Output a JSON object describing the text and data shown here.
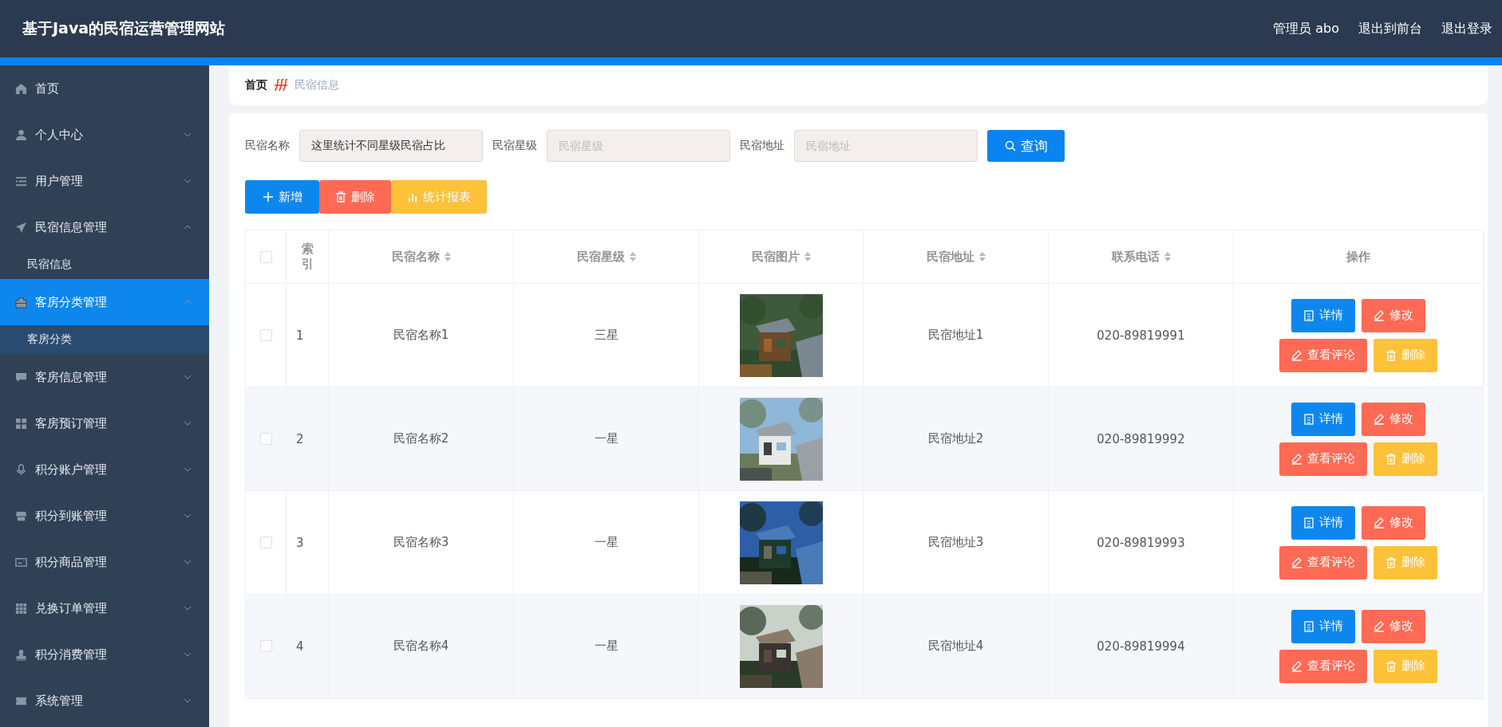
{
  "header": {
    "title": "基于Java的民宿运营管理网站",
    "links": [
      "管理员 abo",
      "退出到前台",
      "退出登录"
    ]
  },
  "sidebar": {
    "items": [
      {
        "label": "首页",
        "expandable": false,
        "selected": false
      },
      {
        "label": "个人中心",
        "expandable": true,
        "expanded": false,
        "selected": false
      },
      {
        "label": "用户管理",
        "expandable": true,
        "expanded": false,
        "selected": false
      },
      {
        "label": "民宿信息管理",
        "expandable": true,
        "expanded": true,
        "selected": false,
        "children": [
          {
            "label": "民宿信息",
            "hovered": false
          }
        ]
      },
      {
        "label": "客房分类管理",
        "expandable": true,
        "expanded": true,
        "selected": true,
        "children": [
          {
            "label": "客房分类",
            "hovered": true
          }
        ]
      },
      {
        "label": "客房信息管理",
        "expandable": true,
        "expanded": false,
        "selected": false
      },
      {
        "label": "客房预订管理",
        "expandable": true,
        "expanded": false,
        "selected": false
      },
      {
        "label": "积分账户管理",
        "expandable": true,
        "expanded": false,
        "selected": false
      },
      {
        "label": "积分到账管理",
        "expandable": true,
        "expanded": false,
        "selected": false
      },
      {
        "label": "积分商品管理",
        "expandable": true,
        "expanded": false,
        "selected": false
      },
      {
        "label": "兑换订单管理",
        "expandable": true,
        "expanded": false,
        "selected": false
      },
      {
        "label": "积分消费管理",
        "expandable": true,
        "expanded": false,
        "selected": false
      },
      {
        "label": "系统管理",
        "expandable": true,
        "expanded": false,
        "selected": false
      }
    ]
  },
  "breadcrumb": [
    "首页",
    "民宿信息"
  ],
  "filters": [
    {
      "label": "民宿名称",
      "value": "这里统计不同星级民宿占比"
    },
    {
      "label": "民宿星级",
      "placeholder": "民宿星级"
    },
    {
      "label": "民宿地址",
      "placeholder": "民宿地址"
    }
  ],
  "search_button": "查询",
  "toolbar": [
    {
      "label": "新增",
      "kind": "add"
    },
    {
      "label": "删除",
      "kind": "delete"
    },
    {
      "label": "统计报表",
      "kind": "report"
    }
  ],
  "table": {
    "all_checked": false,
    "columns": [
      {
        "label": "索引",
        "sortable": false
      },
      {
        "label": "民宿名称",
        "sortable": true
      },
      {
        "label": "民宿星级",
        "sortable": true
      },
      {
        "label": "民宿图片",
        "sortable": true
      },
      {
        "label": "民宿地址",
        "sortable": true
      },
      {
        "label": "联系电话",
        "sortable": true
      },
      {
        "label": "操作",
        "sortable": false
      }
    ],
    "rows": [
      {
        "checked": false,
        "index": "1",
        "name": "民宿名称1",
        "stars": "三星",
        "address": "民宿地址1",
        "phone": "020-89819991",
        "actions": [
          {
            "label": "详情",
            "kind": "detail"
          },
          {
            "label": "修改",
            "kind": "edit"
          },
          {
            "label": "查看评论",
            "kind": "review"
          },
          {
            "label": "删除",
            "kind": "delete"
          }
        ]
      },
      {
        "checked": false,
        "index": "2",
        "name": "民宿名称2",
        "stars": "一星",
        "address": "民宿地址2",
        "phone": "020-89819992",
        "actions": [
          {
            "label": "详情",
            "kind": "detail"
          },
          {
            "label": "修改",
            "kind": "edit"
          },
          {
            "label": "查看评论",
            "kind": "review"
          },
          {
            "label": "删除",
            "kind": "delete"
          }
        ]
      },
      {
        "checked": false,
        "index": "3",
        "name": "民宿名称3",
        "stars": "一星",
        "address": "民宿地址3",
        "phone": "020-89819993",
        "actions": [
          {
            "label": "详情",
            "kind": "detail"
          },
          {
            "label": "修改",
            "kind": "edit"
          },
          {
            "label": "查看评论",
            "kind": "review"
          },
          {
            "label": "删除",
            "kind": "delete"
          }
        ]
      },
      {
        "checked": false,
        "index": "4",
        "name": "民宿名称4",
        "stars": "一星",
        "address": "民宿地址4",
        "phone": "020-89819994",
        "actions": [
          {
            "label": "详情",
            "kind": "detail"
          },
          {
            "label": "修改",
            "kind": "edit"
          },
          {
            "label": "查看评论",
            "kind": "review"
          },
          {
            "label": "删除",
            "kind": "delete"
          }
        ]
      }
    ]
  }
}
